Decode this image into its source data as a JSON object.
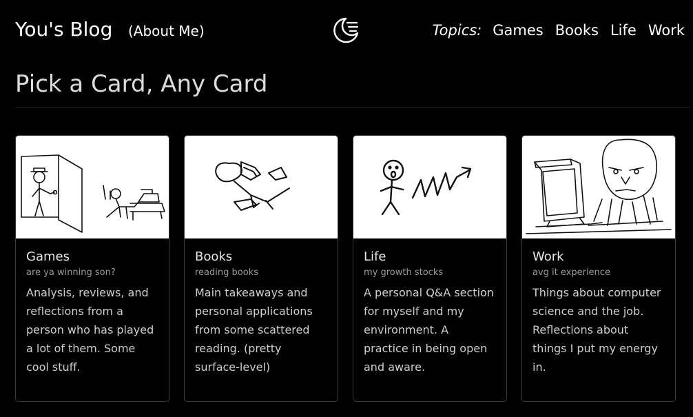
{
  "header": {
    "brand": "You's Blog",
    "about": "(About Me)",
    "theme_toggle_icon": "moon-icon",
    "topics_label": "Topics:",
    "topics": [
      "Games",
      "Books",
      "Life",
      "Work"
    ]
  },
  "main": {
    "title": "Pick a Card, Any Card"
  },
  "cards": [
    {
      "title": "Games",
      "subtitle": "are ya winning son?",
      "text": "Analysis, reviews, and reflections from a person who has played a lot of them. Some cool stuff.",
      "image": "stickman-door-gamer-drawing"
    },
    {
      "title": "Books",
      "subtitle": "reading books",
      "text": "Main takeaways and personal applications from some scattered reading. (pretty surface-level)",
      "image": "person-reading-books-drawing"
    },
    {
      "title": "Life",
      "subtitle": "my growth stocks",
      "text": "A personal Q&A section for myself and my environment. A practice in being open and aware.",
      "image": "stickman-rising-arrow-drawing"
    },
    {
      "title": "Work",
      "subtitle": "avg it experience",
      "text": "Things about computer science and the job. Reflections about things I put my energy in.",
      "image": "man-at-computer-meme-drawing"
    }
  ]
}
